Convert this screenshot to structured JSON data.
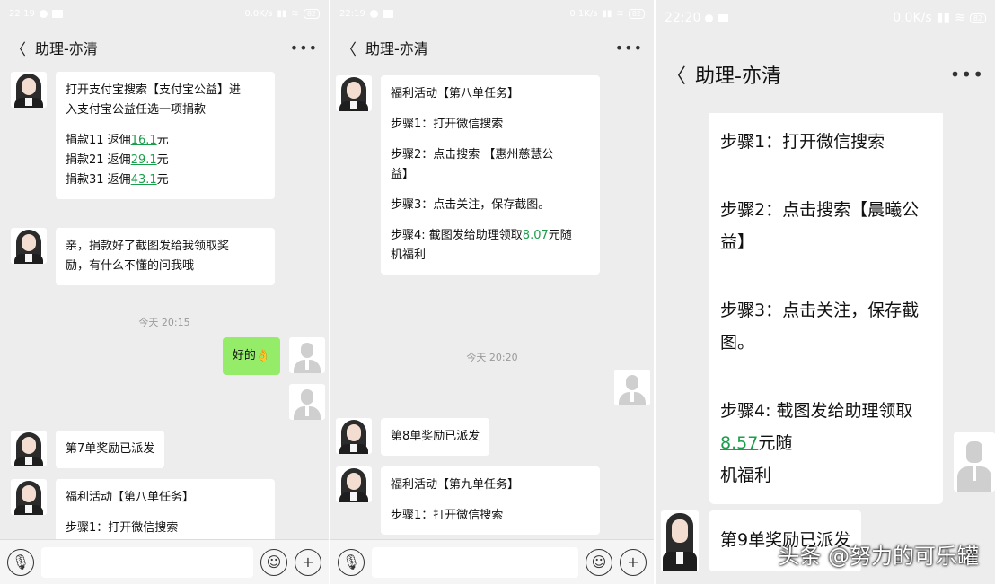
{
  "panel1": {
    "status": {
      "time": "22:19",
      "net": "0.0K/s",
      "battery": "82"
    },
    "nav": {
      "back": "〈",
      "title": "助理-亦清",
      "more": "•••"
    },
    "msg1": {
      "lines": [
        "打开支付宝搜索【支付宝公益】进",
        "入支付宝公益任选一项捐款"
      ],
      "donations": [
        {
          "pre": "捐款11 返佣",
          "amt": "16.1",
          "post": "元"
        },
        {
          "pre": "捐款21 返佣",
          "amt": "29.1",
          "post": "元"
        },
        {
          "pre": "捐款31 返佣",
          "amt": "43.1",
          "post": "元"
        }
      ]
    },
    "msg2": {
      "lines": [
        "亲，捐款好了截图发给我领取奖",
        "励，有什么不懂的问我哦"
      ]
    },
    "time1": "今天 20:15",
    "reply": "好的👌",
    "msg3": "第7单奖励已派发",
    "msg4": {
      "title": "福利活动【第八单任务】",
      "partial": "步骤1：打开微信搜索"
    }
  },
  "panel2": {
    "status": {
      "time": "22:19",
      "net": "0.1K/s",
      "battery": "82"
    },
    "nav": {
      "back": "〈",
      "title": "助理-亦清",
      "more": "•••"
    },
    "msg1": {
      "title": "福利活动【第八单任务】",
      "step1": "步骤1：打开微信搜索",
      "step2": [
        "步骤2：点击搜索 【惠州慈慧公",
        "益】"
      ],
      "step3": "步骤3：点击关注，保存截图。",
      "step4": {
        "pre": "步骤4: 截图发给助理领取",
        "amt": "8.07",
        "post": "元随",
        "line2": "机福利"
      }
    },
    "time1": "今天 20:20",
    "msg2": "第8单奖励已派发",
    "msg3": {
      "title": "福利活动【第九单任务】",
      "step1": "步骤1：打开微信搜索"
    }
  },
  "panel3": {
    "status": {
      "time": "22:20",
      "net": "0.0K/s",
      "battery": "82"
    },
    "nav": {
      "back": "〈",
      "title": "助理-亦清",
      "more": "•••"
    },
    "msg1": {
      "step1": "步骤1：打开微信搜索",
      "step2": "步骤2：点击搜索【晨曦公益】",
      "step3": "步骤3：点击关注，保存截图。",
      "step4": {
        "pre": "步骤4: 截图发给助理领取",
        "amt": "8.57",
        "post": "元随",
        "line2": "机福利"
      }
    },
    "msg2": "第9单奖励已派发"
  },
  "watermark": "头条 @努力的可乐罐"
}
